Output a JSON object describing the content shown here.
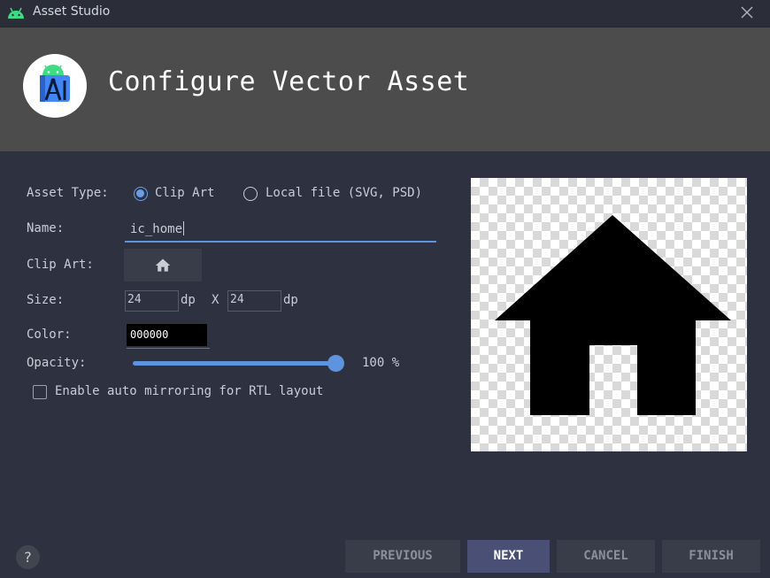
{
  "window": {
    "title": "Asset Studio",
    "close_icon": "close-icon"
  },
  "header": {
    "heading": "Configure Vector Asset",
    "logo_icon": "android-studio-logo-icon"
  },
  "form": {
    "asset_type_label": "Asset Type:",
    "asset_type_options": [
      {
        "label": "Clip Art",
        "selected": true
      },
      {
        "label": "Local file (SVG, PSD)",
        "selected": false
      }
    ],
    "name_label": "Name:",
    "name_value": "ic_home",
    "clip_art_label": "Clip Art:",
    "clip_art_icon": "home-icon",
    "size_label": "Size:",
    "width_value": "24",
    "width_unit": "dp",
    "size_separator": "X",
    "height_value": "24",
    "height_unit": "dp",
    "color_label": "Color:",
    "color_value": "000000",
    "opacity_label": "Opacity:",
    "opacity_value": 100,
    "opacity_text": "100 %",
    "rtl_checkbox_label": "Enable auto mirroring for RTL layout",
    "rtl_checked": false
  },
  "preview": {
    "icon": "home-icon",
    "background": "transparency-checkerboard"
  },
  "footer": {
    "help_label": "?",
    "buttons": {
      "previous": "PREVIOUS",
      "next": "NEXT",
      "cancel": "CANCEL",
      "finish": "FINISH"
    }
  },
  "colors": {
    "accent": "#5e93de",
    "background": "#2e3240",
    "header": "#4c4c4c",
    "primary_button": "#4a4f76"
  }
}
